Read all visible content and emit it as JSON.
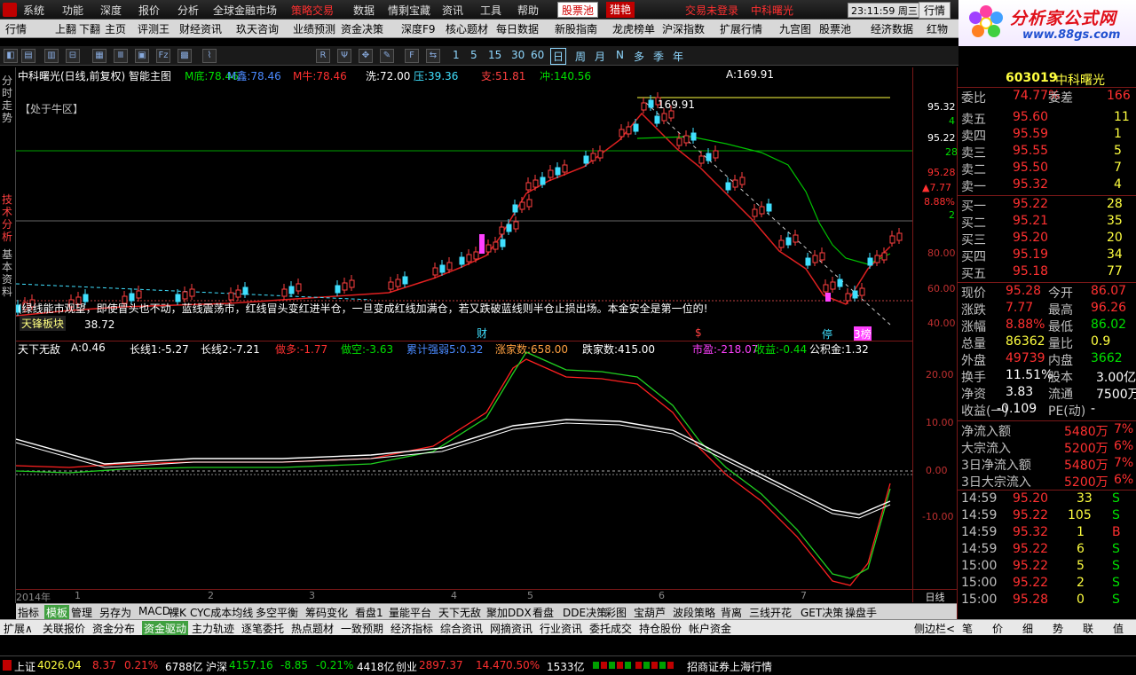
{
  "menu": [
    "系统",
    "功能",
    "深度",
    "报价",
    "分析",
    "全球金融市场",
    "策略交易",
    "数据",
    "情剩宝藏",
    "资讯",
    "工具",
    "帮助",
    "股票池",
    "猎艳",
    "交易未登录",
    "中科曙光"
  ],
  "clock": "23:11:59 周三",
  "hq_button": "行情",
  "logo": {
    "title": "分析家公式网",
    "url": "www.88gs.com"
  },
  "toolbar1": [
    "行情",
    "上翻",
    "下翻",
    "主页",
    "评测王",
    "财经资讯",
    "玖天咨询",
    "业绩预测",
    "资金决策",
    "深度F9",
    "核心题材",
    "每日数据",
    "新股指南",
    "龙虎榜单",
    "沪深指数",
    "扩展行情",
    "九宫图",
    "股票池",
    "经济数据",
    "红物"
  ],
  "toolbar2": {
    "periods": [
      "1",
      "5",
      "15",
      "30",
      "60",
      "日",
      "周",
      "月",
      "N",
      "多",
      "季",
      "年"
    ]
  },
  "leftnav": [
    "分时走势",
    "技术分析",
    "基本资料"
  ],
  "main_chart": {
    "title": "中科曙光(日线,前复权) 智能主图",
    "indicators": [
      {
        "l": "M底:",
        "v": "78.46"
      },
      {
        "l": "M鑫:",
        "v": "78.46"
      },
      {
        "l": "M牛:",
        "v": "78.46"
      },
      {
        "l": "洗:",
        "v": "72.00"
      },
      {
        "l": "压:",
        "v": "39.36"
      },
      {
        "l": "支:",
        "v": "51.81"
      },
      {
        "l": "冲:",
        "v": "140.56"
      },
      {
        "l": "A:",
        "v": "169.91"
      }
    ],
    "zone_label": "【处于牛区】",
    "peak_label": "169.91",
    "low_label": "38.72",
    "ticker_text": "(绿线能市观望，即使冒头也不动，蓝线震荡市，红线冒头变红进半仓，一旦变成红线加满仓，若又跌破蓝线则半仓止损出场。本金安全是第一位的!",
    "sector_label": "天锋板块",
    "markers": [
      "财",
      "$",
      "停",
      "3榜"
    ]
  },
  "yaxis1": {
    "top_value": "95.32",
    "top_count": "4",
    "v2": "95.22",
    "v2c": "28",
    "v3": "95.28",
    "v3c": "▲7.77",
    "v3p": "8.88%",
    "v3n": "2",
    "ticks": [
      "80.00",
      "60.00",
      "40.00"
    ]
  },
  "sub_chart": {
    "name": "天下无敌",
    "values": [
      {
        "l": "A:",
        "v": "0.46",
        "c": "wht"
      },
      {
        "l": "长线1:",
        "v": "-5.27",
        "c": "wht"
      },
      {
        "l": "长线2:",
        "v": "-7.21",
        "c": "wht"
      },
      {
        "l": "做多:",
        "v": "-1.77",
        "c": "red"
      },
      {
        "l": "做空:",
        "v": "-3.63",
        "c": "grn"
      },
      {
        "l": "累计强弱5:",
        "v": "0.32",
        "c": "blu"
      },
      {
        "l": "涨家数:",
        "v": "658.00",
        "c": "org"
      },
      {
        "l": "跌家数:",
        "v": "415.00",
        "c": "wht"
      },
      {
        "l": "市盈:",
        "v": "-218.07",
        "c": "mag"
      },
      {
        "l": "收益:",
        "v": "-0.44",
        "c": "grn"
      },
      {
        "l": "公积金:",
        "v": "1.32",
        "c": "wht"
      }
    ],
    "ticks": [
      "20.00",
      "10.00",
      "0.00",
      "-10.00"
    ]
  },
  "xaxis": [
    "2014年",
    "1",
    "2",
    "3",
    "4",
    "5",
    "6",
    "7"
  ],
  "tabs": [
    "指标",
    "模板",
    "管理",
    "另存为",
    "MACD",
    "裸K",
    "CYC成本均线",
    "多空平衡",
    "筹码变化",
    "看盘1",
    "量能平台",
    "天下无敌",
    "聚加DDX",
    "看盘",
    "DDE决策",
    "彩图",
    "宝葫芦",
    "波段策略",
    "背离",
    "三线开花",
    "GET决策",
    "操盘手"
  ],
  "botbar": [
    "扩展∧",
    "关联报价",
    "资金分布",
    "资金驱动",
    "主力轨迹",
    "逐笔委托",
    "热点题材",
    "一致预期",
    "经济指标",
    "综合资讯",
    "网摘资讯",
    "行业资讯",
    "委托成交",
    "持仓股份",
    "帐户资金"
  ],
  "right": {
    "code": "603019",
    "name": "中科曙光",
    "weibi": {
      "l": "委比",
      "v": "74.77%",
      "l2": "委差",
      "v2": "166"
    },
    "sell": [
      {
        "l": "卖五",
        "p": "95.60",
        "n": "11"
      },
      {
        "l": "卖四",
        "p": "95.59",
        "n": "1"
      },
      {
        "l": "卖三",
        "p": "95.55",
        "n": "5"
      },
      {
        "l": "卖二",
        "p": "95.50",
        "n": "7"
      },
      {
        "l": "卖一",
        "p": "95.32",
        "n": "4"
      }
    ],
    "buy": [
      {
        "l": "买一",
        "p": "95.22",
        "n": "28"
      },
      {
        "l": "买二",
        "p": "95.21",
        "n": "35"
      },
      {
        "l": "买三",
        "p": "95.20",
        "n": "20"
      },
      {
        "l": "买四",
        "p": "95.19",
        "n": "34"
      },
      {
        "l": "买五",
        "p": "95.18",
        "n": "77"
      }
    ],
    "stats": [
      [
        "现价",
        "95.28",
        "今开",
        "86.07"
      ],
      [
        "涨跌",
        "7.77",
        "最高",
        "96.26"
      ],
      [
        "涨幅",
        "8.88%",
        "最低",
        "86.02"
      ],
      [
        "总量",
        "86362",
        "量比",
        "0.9"
      ],
      [
        "外盘",
        "49739",
        "内盘",
        "3662"
      ],
      [
        "换手",
        "11.51%",
        "股本",
        "3.00亿"
      ],
      [
        "净资",
        "3.83",
        "流通",
        "7500万"
      ],
      [
        "收益(一)",
        "-0.109",
        "PE(动)",
        "-"
      ]
    ],
    "flows": [
      [
        "净流入额",
        "5480万",
        "7%"
      ],
      [
        "大宗流入",
        "5200万",
        "6%"
      ],
      [
        "3日净流入额",
        "5480万",
        "7%"
      ],
      [
        "3日大宗流入",
        "5200万",
        "6%"
      ]
    ],
    "ticks": [
      [
        "14:59",
        "95.20",
        "33",
        "S"
      ],
      [
        "14:59",
        "95.22",
        "105",
        "S"
      ],
      [
        "14:59",
        "95.32",
        "1",
        "B"
      ],
      [
        "14:59",
        "95.22",
        "6",
        "S"
      ],
      [
        "15:00",
        "95.22",
        "5",
        "S"
      ],
      [
        "15:00",
        "95.22",
        "2",
        "S"
      ],
      [
        "15:00",
        "95.28",
        "0",
        "S"
      ]
    ],
    "tabs": [
      "笔",
      "价",
      "细",
      "势",
      "联",
      "值"
    ]
  },
  "rightaxis_labels": [
    "侧边栏<"
  ],
  "status": {
    "sh_l": "上证",
    "sh_v": "4026.04",
    "sh_c": "8.37",
    "sh_p": "0.21%",
    "sh_a": "6788亿",
    "hs_l": "沪深",
    "hs_v": "4157.16",
    "hs_c": "-8.85",
    "hs_p": "-0.21%",
    "hs_a": "4418亿",
    "cy_l": "创业",
    "cy_v": "2897.37",
    "cy_c": "14.47",
    "cy_p": "0.50%",
    "cy_a": "1533亿",
    "broker": "招商证券上海行情"
  },
  "colors": {
    "up": "#ff3030",
    "down": "#00e000",
    "accent": "#ffff40",
    "border": "#7a1818"
  }
}
